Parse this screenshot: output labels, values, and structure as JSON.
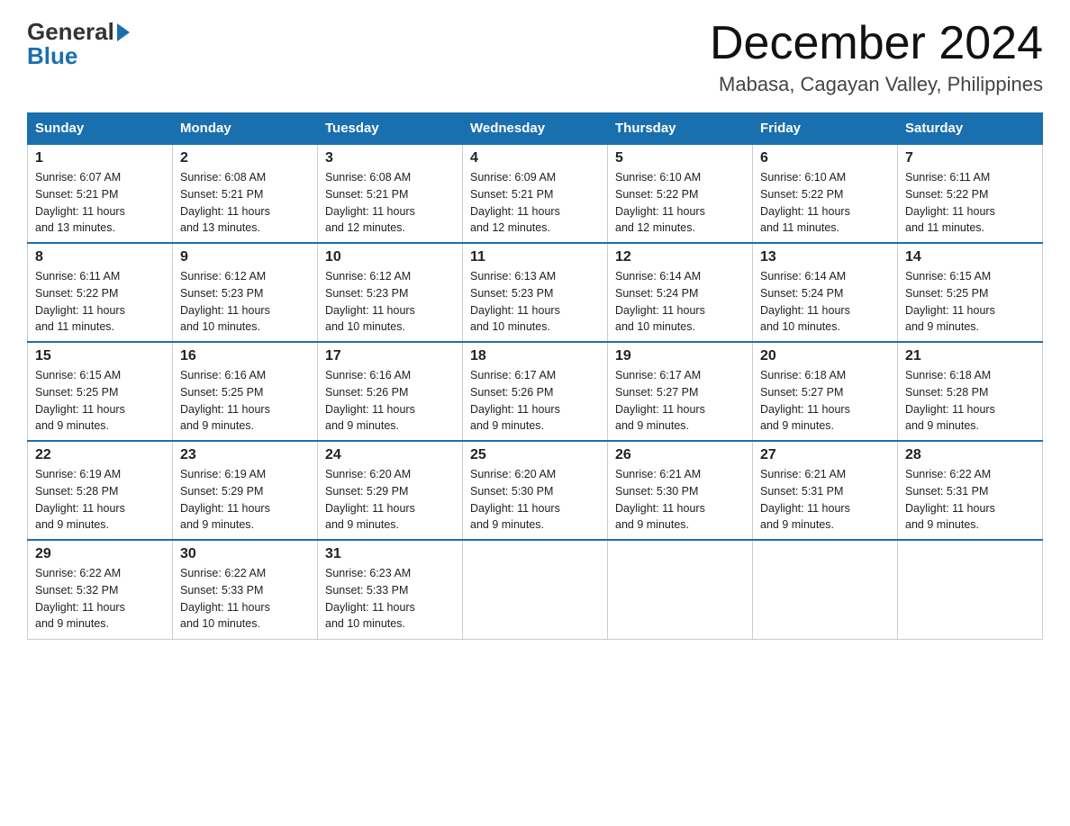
{
  "logo": {
    "general": "General",
    "blue": "Blue"
  },
  "title": "December 2024",
  "location": "Mabasa, Cagayan Valley, Philippines",
  "days_of_week": [
    "Sunday",
    "Monday",
    "Tuesday",
    "Wednesday",
    "Thursday",
    "Friday",
    "Saturday"
  ],
  "weeks": [
    [
      {
        "day": "1",
        "sunrise": "6:07 AM",
        "sunset": "5:21 PM",
        "daylight": "11 hours and 13 minutes."
      },
      {
        "day": "2",
        "sunrise": "6:08 AM",
        "sunset": "5:21 PM",
        "daylight": "11 hours and 13 minutes."
      },
      {
        "day": "3",
        "sunrise": "6:08 AM",
        "sunset": "5:21 PM",
        "daylight": "11 hours and 12 minutes."
      },
      {
        "day": "4",
        "sunrise": "6:09 AM",
        "sunset": "5:21 PM",
        "daylight": "11 hours and 12 minutes."
      },
      {
        "day": "5",
        "sunrise": "6:10 AM",
        "sunset": "5:22 PM",
        "daylight": "11 hours and 12 minutes."
      },
      {
        "day": "6",
        "sunrise": "6:10 AM",
        "sunset": "5:22 PM",
        "daylight": "11 hours and 11 minutes."
      },
      {
        "day": "7",
        "sunrise": "6:11 AM",
        "sunset": "5:22 PM",
        "daylight": "11 hours and 11 minutes."
      }
    ],
    [
      {
        "day": "8",
        "sunrise": "6:11 AM",
        "sunset": "5:22 PM",
        "daylight": "11 hours and 11 minutes."
      },
      {
        "day": "9",
        "sunrise": "6:12 AM",
        "sunset": "5:23 PM",
        "daylight": "11 hours and 10 minutes."
      },
      {
        "day": "10",
        "sunrise": "6:12 AM",
        "sunset": "5:23 PM",
        "daylight": "11 hours and 10 minutes."
      },
      {
        "day": "11",
        "sunrise": "6:13 AM",
        "sunset": "5:23 PM",
        "daylight": "11 hours and 10 minutes."
      },
      {
        "day": "12",
        "sunrise": "6:14 AM",
        "sunset": "5:24 PM",
        "daylight": "11 hours and 10 minutes."
      },
      {
        "day": "13",
        "sunrise": "6:14 AM",
        "sunset": "5:24 PM",
        "daylight": "11 hours and 10 minutes."
      },
      {
        "day": "14",
        "sunrise": "6:15 AM",
        "sunset": "5:25 PM",
        "daylight": "11 hours and 9 minutes."
      }
    ],
    [
      {
        "day": "15",
        "sunrise": "6:15 AM",
        "sunset": "5:25 PM",
        "daylight": "11 hours and 9 minutes."
      },
      {
        "day": "16",
        "sunrise": "6:16 AM",
        "sunset": "5:25 PM",
        "daylight": "11 hours and 9 minutes."
      },
      {
        "day": "17",
        "sunrise": "6:16 AM",
        "sunset": "5:26 PM",
        "daylight": "11 hours and 9 minutes."
      },
      {
        "day": "18",
        "sunrise": "6:17 AM",
        "sunset": "5:26 PM",
        "daylight": "11 hours and 9 minutes."
      },
      {
        "day": "19",
        "sunrise": "6:17 AM",
        "sunset": "5:27 PM",
        "daylight": "11 hours and 9 minutes."
      },
      {
        "day": "20",
        "sunrise": "6:18 AM",
        "sunset": "5:27 PM",
        "daylight": "11 hours and 9 minutes."
      },
      {
        "day": "21",
        "sunrise": "6:18 AM",
        "sunset": "5:28 PM",
        "daylight": "11 hours and 9 minutes."
      }
    ],
    [
      {
        "day": "22",
        "sunrise": "6:19 AM",
        "sunset": "5:28 PM",
        "daylight": "11 hours and 9 minutes."
      },
      {
        "day": "23",
        "sunrise": "6:19 AM",
        "sunset": "5:29 PM",
        "daylight": "11 hours and 9 minutes."
      },
      {
        "day": "24",
        "sunrise": "6:20 AM",
        "sunset": "5:29 PM",
        "daylight": "11 hours and 9 minutes."
      },
      {
        "day": "25",
        "sunrise": "6:20 AM",
        "sunset": "5:30 PM",
        "daylight": "11 hours and 9 minutes."
      },
      {
        "day": "26",
        "sunrise": "6:21 AM",
        "sunset": "5:30 PM",
        "daylight": "11 hours and 9 minutes."
      },
      {
        "day": "27",
        "sunrise": "6:21 AM",
        "sunset": "5:31 PM",
        "daylight": "11 hours and 9 minutes."
      },
      {
        "day": "28",
        "sunrise": "6:22 AM",
        "sunset": "5:31 PM",
        "daylight": "11 hours and 9 minutes."
      }
    ],
    [
      {
        "day": "29",
        "sunrise": "6:22 AM",
        "sunset": "5:32 PM",
        "daylight": "11 hours and 9 minutes."
      },
      {
        "day": "30",
        "sunrise": "6:22 AM",
        "sunset": "5:33 PM",
        "daylight": "11 hours and 10 minutes."
      },
      {
        "day": "31",
        "sunrise": "6:23 AM",
        "sunset": "5:33 PM",
        "daylight": "11 hours and 10 minutes."
      },
      null,
      null,
      null,
      null
    ]
  ],
  "labels": {
    "sunrise": "Sunrise:",
    "sunset": "Sunset:",
    "daylight": "Daylight:"
  }
}
